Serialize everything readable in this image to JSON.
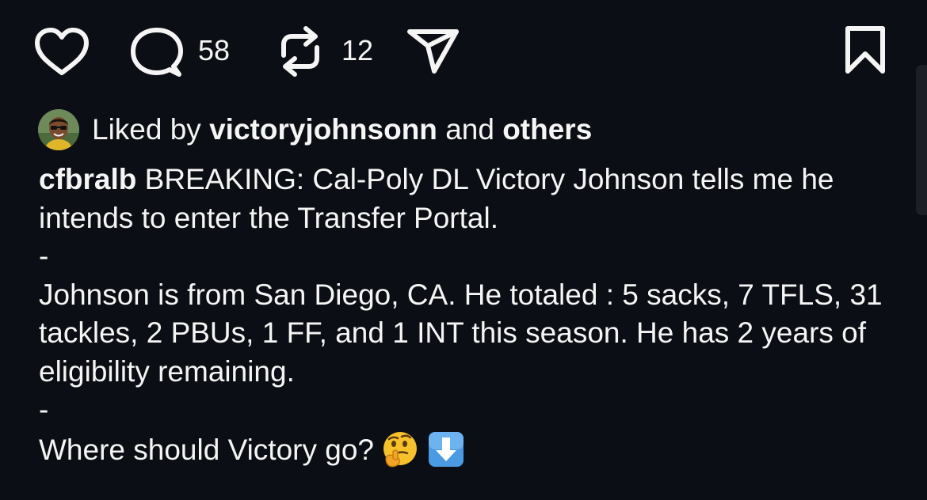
{
  "actions": {
    "comment_count": "58",
    "repost_count": "12"
  },
  "likes": {
    "prefix": "Liked by",
    "user": "victoryjohnsonn",
    "middle": "and",
    "suffix": "others"
  },
  "caption": {
    "author": "cfbralb",
    "line1": "BREAKING: Cal-Poly DL Victory Johnson tells me he intends to enter the Transfer Portal.",
    "sep1": "-",
    "line2": "Johnson is from San Diego, CA. He totaled : 5 sacks, 7 TFLS, 31 tackles, 2 PBUs, 1 FF, and 1 INT this season. He has 2 years of eligibility remaining.",
    "sep2": "-",
    "line3": "Where should Victory go?"
  },
  "icons": {
    "like": "heart-icon",
    "comment": "comment-bubble-icon",
    "repost": "repost-icon",
    "share": "paper-plane-icon",
    "save": "bookmark-icon",
    "emoji1": "thinking-face-emoji",
    "emoji2": "down-arrow-emoji"
  },
  "colors": {
    "background": "#0b0e14",
    "text": "#f5f5f5"
  }
}
